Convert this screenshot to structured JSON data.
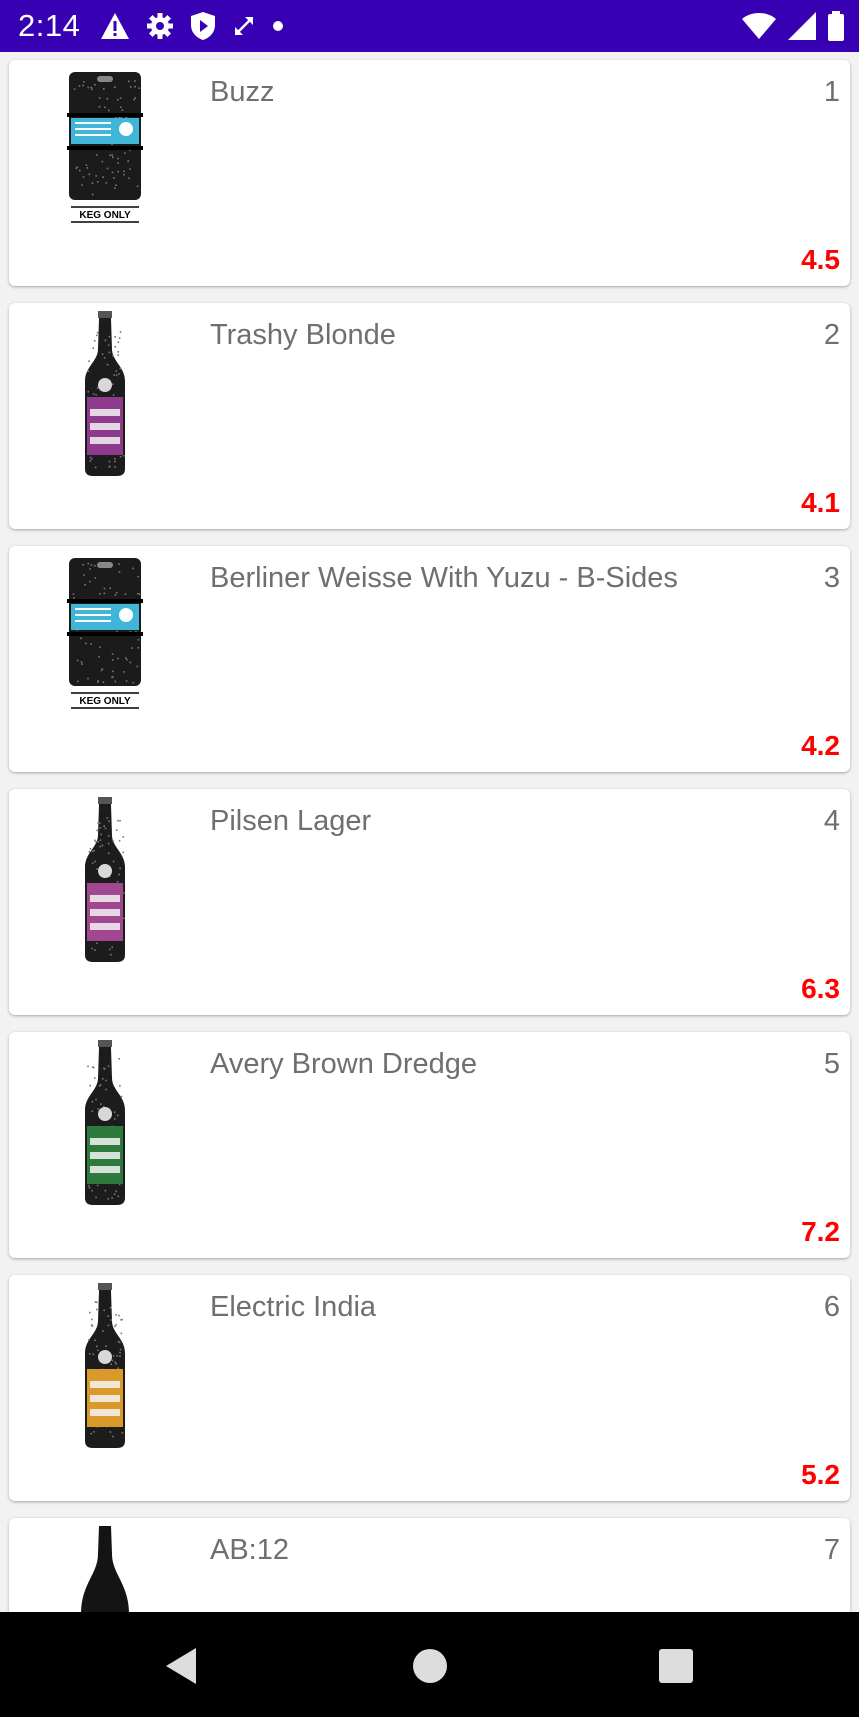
{
  "status_bar": {
    "time": "2:14",
    "background": "#3700b3",
    "icons_left": [
      "warning-icon",
      "gear-icon",
      "shield-icon",
      "expand-icon",
      "dot-icon"
    ],
    "icons_right": [
      "wifi-icon",
      "signal-icon",
      "battery-icon"
    ]
  },
  "beers": [
    {
      "name": "Buzz",
      "id": "1",
      "abv": "4.5",
      "image": "keg",
      "label_color": "#3fb6d8",
      "keg_label": "KEG ONLY"
    },
    {
      "name": "Trashy Blonde",
      "id": "2",
      "abv": "4.1",
      "image": "bottle",
      "label_color": "#8e3a8f"
    },
    {
      "name": "Berliner Weisse With Yuzu - B-Sides",
      "id": "3",
      "abv": "4.2",
      "image": "keg",
      "label_color": "#3fb6d8",
      "keg_label": "KEG ONLY"
    },
    {
      "name": "Pilsen Lager",
      "id": "4",
      "abv": "6.3",
      "image": "bottle",
      "label_color": "#a1478f"
    },
    {
      "name": "Avery Brown Dredge",
      "id": "5",
      "abv": "7.2",
      "image": "bottle",
      "label_color": "#2e7a3c"
    },
    {
      "name": "Electric India",
      "id": "6",
      "abv": "5.2",
      "image": "bottle",
      "label_color": "#d99a2b"
    },
    {
      "name": "AB:12",
      "id": "7",
      "abv": "",
      "image": "tall-bottle",
      "label_color": "#111111"
    }
  ],
  "abv_color": "#ff0000",
  "nav_bar": {
    "buttons": [
      "back-icon",
      "home-icon",
      "recents-icon"
    ]
  }
}
